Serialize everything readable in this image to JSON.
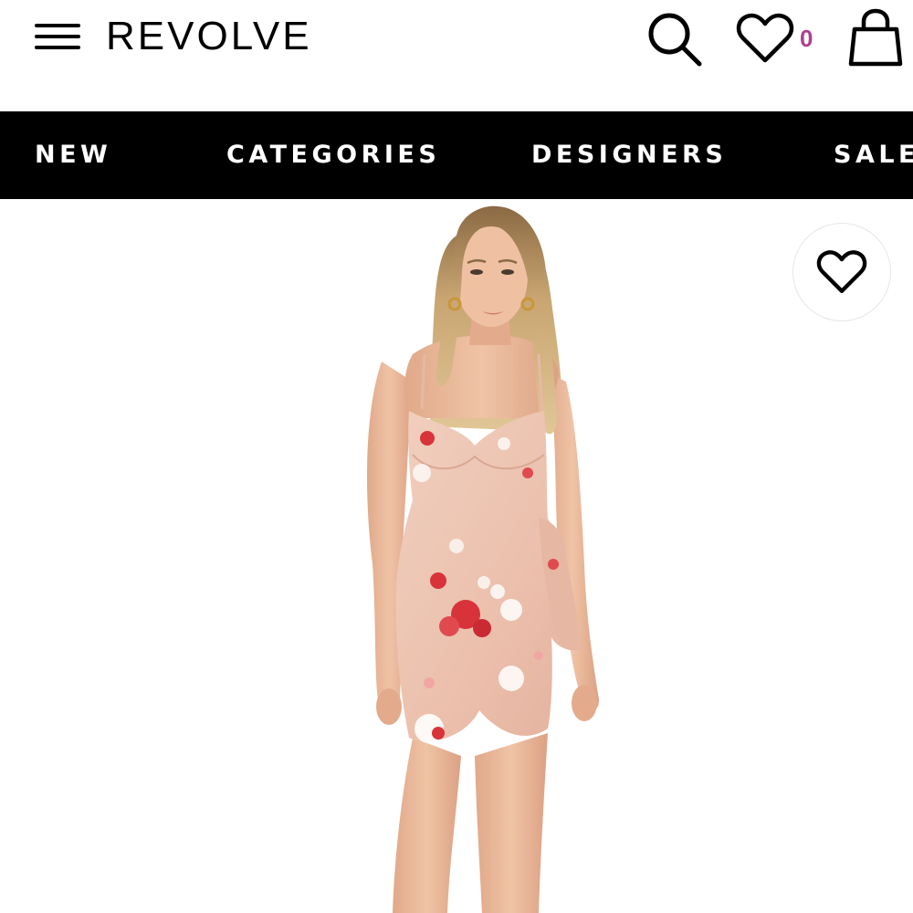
{
  "header": {
    "brand": "REVOLVE",
    "menu_icon": "hamburger-menu-icon",
    "search_icon": "search-icon",
    "wishlist_icon": "heart-outline-icon",
    "wishlist_count": "0",
    "bag_icon": "shopping-bag-icon"
  },
  "nav": {
    "items": [
      "NEW",
      "CATEGORIES",
      "DESIGNERS",
      "SALE"
    ]
  },
  "product": {
    "favorite_icon": "heart-outline-icon",
    "image_description_icon": "product-photo"
  },
  "colors": {
    "accent": "#b0408f",
    "nav_background": "#000000",
    "dress_base": "#eec3b2",
    "floral_red": "#d8333a"
  }
}
